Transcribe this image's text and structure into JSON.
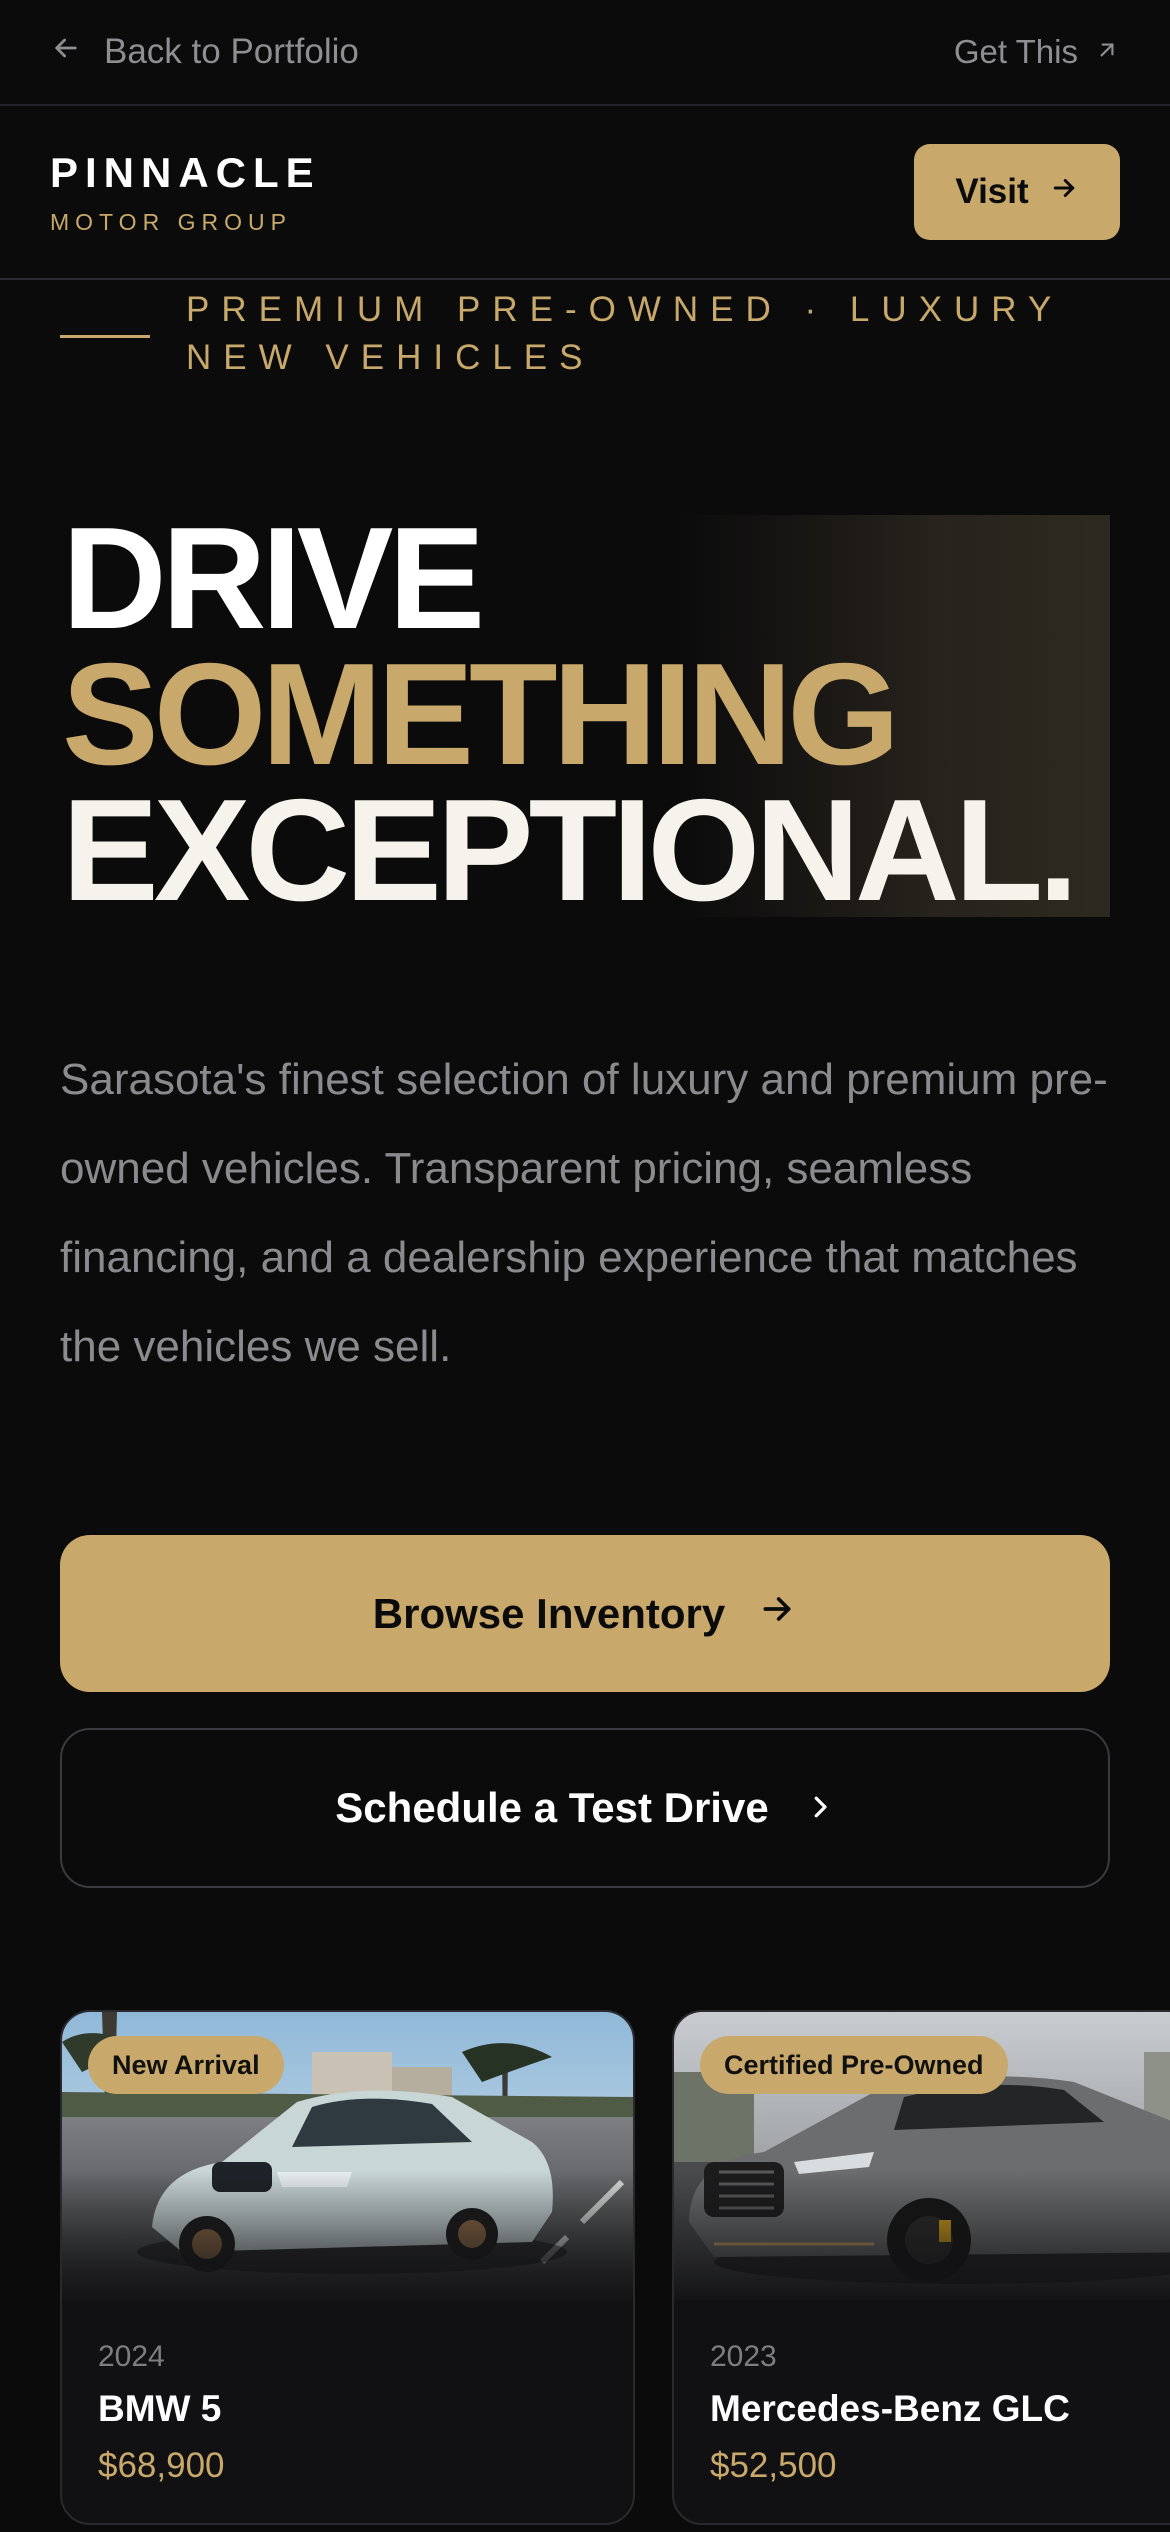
{
  "topbar": {
    "back_label": "Back to Portfolio",
    "get_label": "Get This"
  },
  "header": {
    "brand_name": "PINNACLE",
    "brand_sub": "MOTOR GROUP",
    "visit_label": "Visit"
  },
  "hero": {
    "eyebrow_line1": "PREMIUM PRE-OWNED · LUXURY",
    "eyebrow_line2": "NEW VEHICLES",
    "headline_1": "DRIVE",
    "headline_2": "SOMETHING",
    "headline_3": "EXCEPTIONAL.",
    "lede": "Sarasota's finest selection of luxury and premium pre-owned vehicles. Transparent pricing, seamless financing, and a dealership experience that matches the vehicles we sell.",
    "cta_primary": "Browse Inventory",
    "cta_secondary": "Schedule a Test Drive"
  },
  "inventory": [
    {
      "badge": "New Arrival",
      "year": "2024",
      "title": "BMW 5",
      "price": "$68,900"
    },
    {
      "badge": "Certified Pre-Owned",
      "year": "2023",
      "title": "Mercedes-Benz GLC",
      "price": "$52,500"
    }
  ],
  "colors": {
    "accent": "#c8a96b",
    "background": "#0b0b0c",
    "muted_text": "#8a8a8f"
  },
  "icons": [
    "arrow-left-icon",
    "arrow-up-right-icon",
    "arrow-right-icon",
    "chevron-right-icon"
  ]
}
